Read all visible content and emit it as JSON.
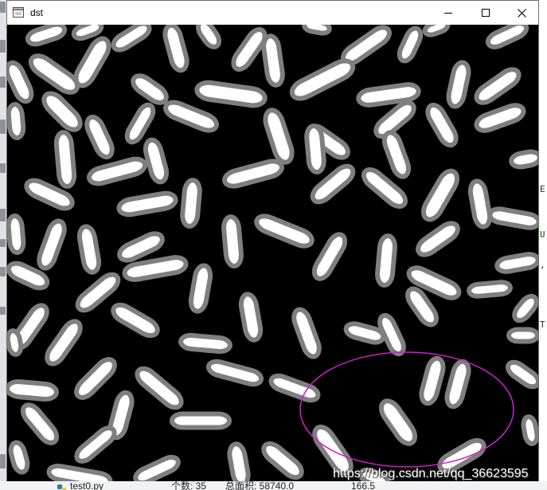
{
  "window": {
    "title": "dst",
    "icon": "window-icon",
    "titlebar_color": "#ffffff",
    "controls": {
      "minimize": "minimize-icon",
      "maximize": "maximize-icon",
      "close": "close-icon"
    }
  },
  "image": {
    "background": "#000000",
    "grain_fill": "#ffffff",
    "grain_outline": "#7f7f7f",
    "highlight_ellipse": "#cc22cc"
  },
  "watermark": {
    "text": "https://blog.csdn.net/qq_36623595"
  },
  "ide": {
    "run_tab": {
      "label": "test0.py",
      "icon": "python-icon"
    },
    "console": {
      "count": "个数: 35",
      "total_area": "总面积: 58740.0",
      "partial_value": "166.5"
    },
    "edge_letters": [
      "E",
      "U",
      ",",
      "T"
    ]
  }
}
